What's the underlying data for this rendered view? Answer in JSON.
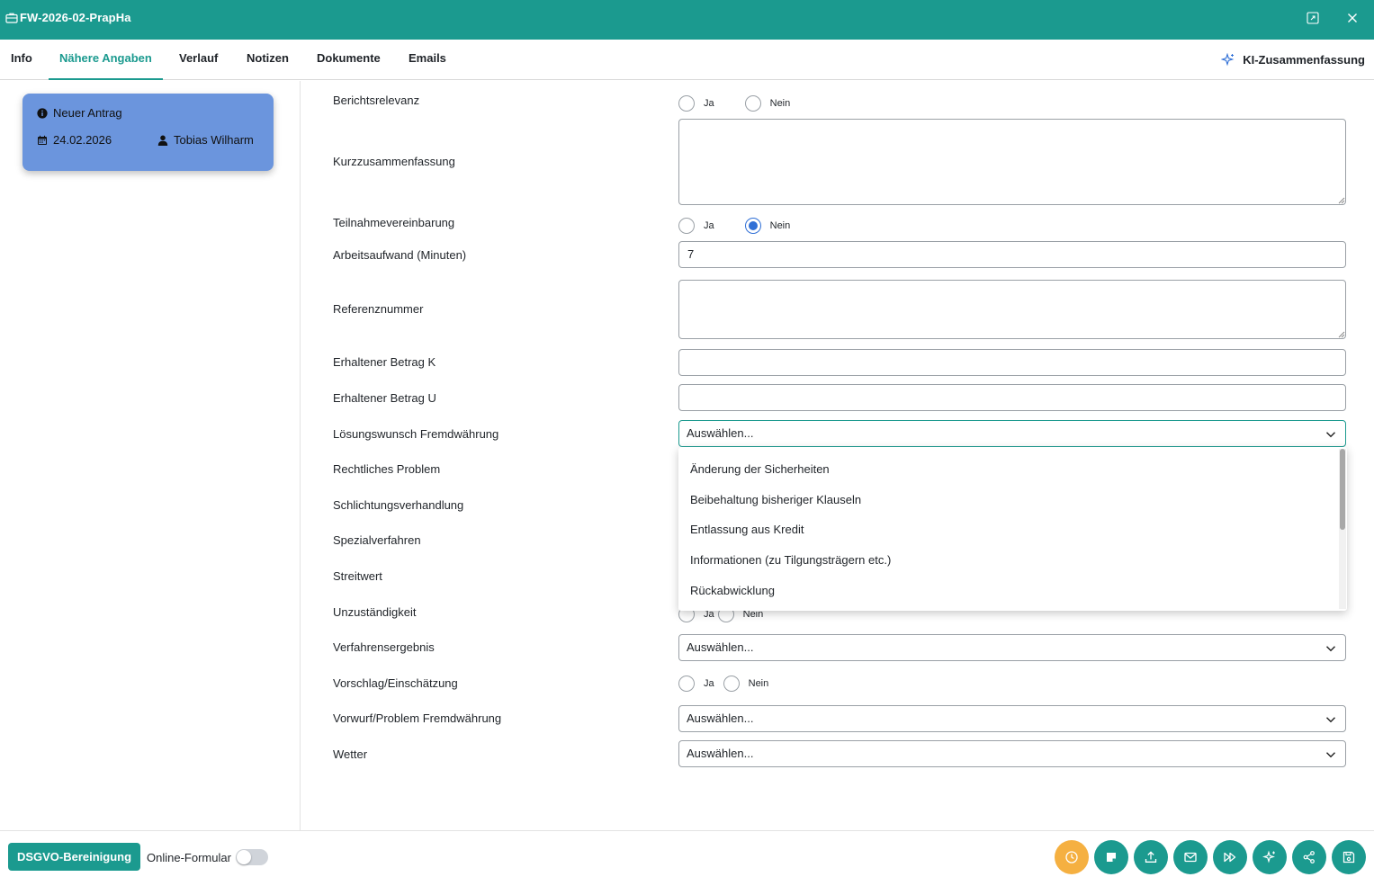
{
  "window": {
    "title": "FW-2026-02-PrapHa"
  },
  "tabs": [
    {
      "label": "Info"
    },
    {
      "label": "Nähere Angaben",
      "active": true
    },
    {
      "label": "Verlauf"
    },
    {
      "label": "Notizen"
    },
    {
      "label": "Dokumente"
    },
    {
      "label": "Emails"
    }
  ],
  "ki_summary": {
    "label": "KI-Zusammenfassung"
  },
  "status_card": {
    "status": "Neuer Antrag",
    "date": "24.02.2026",
    "user": "Tobias Wilharm",
    "color": "#6b95dd"
  },
  "form": {
    "berichtsrelevanz": {
      "label": "Berichtsrelevanz",
      "options": [
        "Ja",
        "Nein"
      ],
      "selected": null
    },
    "kurzzusammenfassung": {
      "label": "Kurzzusammenfassung",
      "value": ""
    },
    "teilnahmevereinbarung": {
      "label": "Teilnahmevereinbarung",
      "options": [
        "Ja",
        "Nein"
      ],
      "selected": "Nein"
    },
    "arbeitsaufwand": {
      "label": "Arbeitsaufwand (Minuten)",
      "value": "7"
    },
    "referenznummer": {
      "label": "Referenznummer",
      "value": ""
    },
    "betrag_k": {
      "label": "Erhaltener Betrag K",
      "value": ""
    },
    "betrag_u": {
      "label": "Erhaltener Betrag U",
      "value": ""
    },
    "loesungswunsch": {
      "label": "Lösungswunsch Fremdwährung",
      "placeholder": "Auswählen...",
      "options": [
        "Änderung der Sicherheiten",
        "Beibehaltung bisheriger Klauseln",
        "Entlassung aus Kredit",
        "Informationen (zu Tilgungsträgern etc.)",
        "Rückabwicklung"
      ]
    },
    "rechtliches_problem": {
      "label": "Rechtliches Problem"
    },
    "schlichtungsverhandlung": {
      "label": "Schlichtungsverhandlung"
    },
    "spezialverfahren": {
      "label": "Spezialverfahren"
    },
    "streitwert": {
      "label": "Streitwert"
    },
    "unzustaendigkeit": {
      "label": "Unzuständigkeit",
      "options": [
        "Ja",
        "Nein"
      ]
    },
    "verfahrensergebnis": {
      "label": "Verfahrensergebnis",
      "placeholder": "Auswählen..."
    },
    "vorschlag": {
      "label": "Vorschlag/Einschätzung",
      "options": [
        "Ja",
        "Nein"
      ],
      "selected": null
    },
    "vorwurf": {
      "label": "Vorwurf/Problem Fremdwährung",
      "placeholder": "Auswählen..."
    },
    "wetter": {
      "label": "Wetter",
      "placeholder": "Auswählen..."
    }
  },
  "bottom": {
    "dsgvo_label": "DSGVO-Bereinigung",
    "online_label": "Online-Formular",
    "online_enabled": false,
    "actions": [
      "clock-icon",
      "note-icon",
      "upload-icon",
      "mail-icon",
      "fast-forward-icon",
      "sparkle-icon",
      "share-icon",
      "save-icon"
    ],
    "accent": "#1b9a8f",
    "warn": "#f5b041"
  }
}
